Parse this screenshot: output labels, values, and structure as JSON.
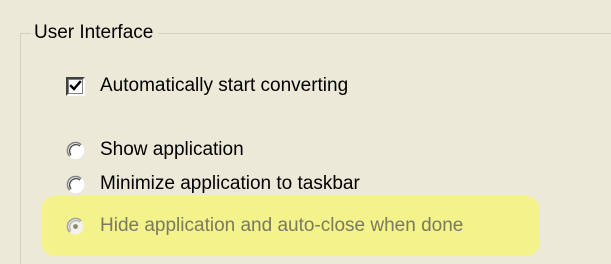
{
  "group": {
    "title": "User Interface"
  },
  "options": {
    "auto_start": {
      "label": "Automatically start converting",
      "checked": true
    },
    "display_mode": {
      "items": [
        {
          "label": "Show application",
          "selected": false
        },
        {
          "label": "Minimize application to taskbar",
          "selected": false
        },
        {
          "label": "Hide application and auto-close when done",
          "selected": true
        }
      ]
    }
  },
  "colors": {
    "background": "#ece9d8",
    "highlight": "#f6f37c",
    "groupbox_border": "#d0d0bf"
  }
}
